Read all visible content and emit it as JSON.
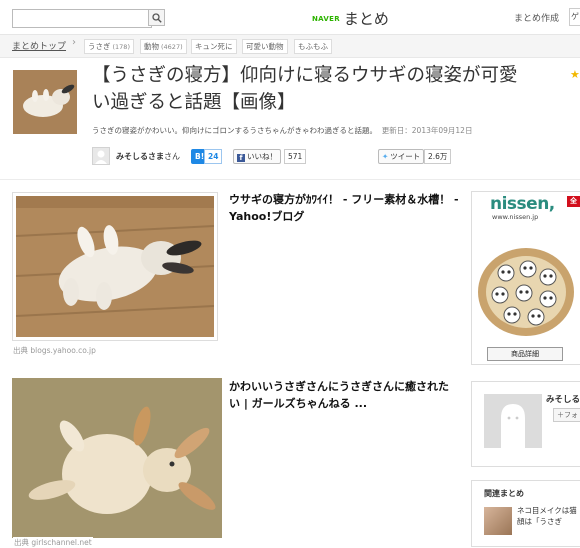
{
  "header": {
    "search_placeholder": "",
    "logo_brand": "NAVER",
    "logo_text": "まとめ",
    "create_link": "まとめ作成",
    "user_menu": "ゲ"
  },
  "breadcrumb": {
    "home": "まとめトップ",
    "separator": "›",
    "tags": [
      {
        "label": "うさぎ",
        "count": "(178)"
      },
      {
        "label": "動物",
        "count": "(4627)"
      },
      {
        "label": "キュン死に",
        "count": ""
      },
      {
        "label": "可愛い動物",
        "count": ""
      },
      {
        "label": "もふもふ",
        "count": ""
      }
    ]
  },
  "article": {
    "title": "【うさぎの寝方】仰向けに寝るウサギの寝姿が可愛い過ぎると話題【画像】",
    "description": "うさぎの寝姿がかわいい。仰向けにゴロンするうさちゃんがきゃわわ過ぎると話題。",
    "updated": "更新日：2013年09月12日",
    "author_name": "みそしるさま",
    "author_suffix": "さん",
    "hatena_label": "B!",
    "hatena_count": "24",
    "fb_label": "いいね！",
    "fb_count": "571",
    "tweet_label": "ツイート",
    "tweet_count": "2.6万"
  },
  "items": [
    {
      "title": "ウサギの寝方がｶﾜｲｲ！ - フリー素材＆水槽！ - Yahoo!ブログ",
      "source": "出典 blogs.yahoo.co.jp"
    },
    {
      "title": "かわいいうさぎさんにうさぎさんに癒されたい | ガールズちゃんねる ...",
      "source": "出典 girlschannel.net"
    }
  ],
  "sidebar": {
    "ad_logo": "nissen,",
    "ad_badge": "全",
    "ad_url": "www.nissen.jp",
    "ad_button": "商品詳細",
    "profile_name": "みそしる",
    "profile_follow": "＋フォ",
    "related_title": "関連まとめ",
    "related_text": "ネコ目メイクは猫顔は「うさぎ"
  },
  "colors": {
    "naver_green": "#2db400",
    "hatena_blue": "#1e88e5",
    "facebook_blue": "#3b5998",
    "twitter_blue": "#55acee",
    "nissen_teal": "#2b8c7f"
  }
}
